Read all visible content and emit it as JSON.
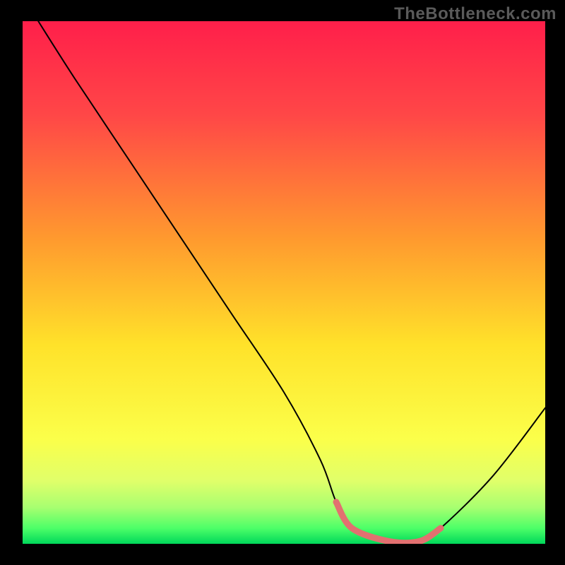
{
  "watermark": "TheBottleneck.com",
  "colors": {
    "black": "#000000",
    "top": "#ff2a55",
    "mid": "#ffe400",
    "green_light": "#d4ff7a",
    "green": "#00e060",
    "curve": "#000000",
    "accent": "#e27070"
  },
  "gradient_stops": [
    {
      "pct": 0,
      "hex": "#ff1f4a"
    },
    {
      "pct": 18,
      "hex": "#ff4747"
    },
    {
      "pct": 42,
      "hex": "#ff9b2e"
    },
    {
      "pct": 62,
      "hex": "#ffe22a"
    },
    {
      "pct": 80,
      "hex": "#fbff4a"
    },
    {
      "pct": 88,
      "hex": "#e0ff6a"
    },
    {
      "pct": 93,
      "hex": "#a8ff70"
    },
    {
      "pct": 97,
      "hex": "#4dff68"
    },
    {
      "pct": 100,
      "hex": "#00d85a"
    }
  ],
  "chart_data": {
    "type": "line",
    "title": "",
    "xlabel": "",
    "ylabel": "",
    "xlim": [
      0,
      100
    ],
    "ylim": [
      0,
      100
    ],
    "series": [
      {
        "name": "main-curve",
        "x": [
          3,
          10,
          20,
          30,
          40,
          50,
          57,
          60,
          63,
          70,
          76,
          80,
          90,
          100
        ],
        "y": [
          100,
          89,
          74,
          59,
          44,
          29,
          16,
          8,
          3,
          0.5,
          0.5,
          3,
          13,
          26
        ]
      },
      {
        "name": "accent-segment",
        "x": [
          60,
          63,
          70,
          76,
          80
        ],
        "y": [
          8,
          3,
          0.5,
          0.5,
          3
        ]
      }
    ],
    "notes": "V-shaped bottleneck curve on heat gradient; trough ~x=70-76, y≈0.5%; accent overlays trough region.",
    "grid": false,
    "legend": false
  }
}
